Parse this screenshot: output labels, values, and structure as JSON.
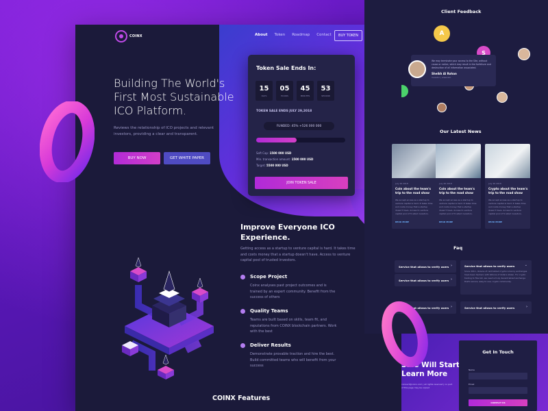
{
  "nav": {
    "logo": "COINX",
    "links": [
      "About",
      "Token",
      "Roadmap",
      "Contact"
    ],
    "buy_token": "BUY TOKEN"
  },
  "hero": {
    "title": "Building The World's First Most Sustainable ICO Platform.",
    "description": "Reviews the relationship of ICO projects and relevant investors, providing a clear and transparent.",
    "buy_now": "BUY NOW",
    "white_paper": "GET WHITE PAPER"
  },
  "token_sale": {
    "title": "Token Sale Ends In:",
    "countdown": [
      {
        "value": "15",
        "label": "DAYS"
      },
      {
        "value": "05",
        "label": "HOURS"
      },
      {
        "value": "45",
        "label": "MINUTES"
      },
      {
        "value": "53",
        "label": "SECOND"
      }
    ],
    "ends_text": "TOKEN SALE ENDS JULY 29,2018",
    "funded": "FUNDED: 45% +526 000 000",
    "progress": 0.45,
    "soft_cap_label": "Soft Cap:",
    "soft_cap": "1500 000 USD",
    "min_tx_label": "Min. transaction amount:",
    "min_tx": "1500 000 USD",
    "target_label": "Target:",
    "target": "5500 000 USD",
    "join": "JOIN TOKEN SALE"
  },
  "improve": {
    "title": "Improve Everyone ICO Experience.",
    "description": "Getting access as a startup to venture capital is hard. It takes time and costs money that a startup doesn't have. Access to venture capital pool of trusted investors.",
    "features": [
      {
        "title": "Scope Project",
        "desc": "Coinx analyses past project outcomes and is trained by an expert community. Benefit from the success of others"
      },
      {
        "title": "Quality Teams",
        "desc": "Teams are built based on skills, team fit, and reputations from COINX blockchain partners. Work with the best"
      },
      {
        "title": "Deliver Results",
        "desc": "Demonstrate provable traction and hire the best. Build committed teams who will benefit from your success"
      }
    ]
  },
  "features_heading": "COINX Features",
  "feedback": {
    "heading": "Client Feedback",
    "text": "We may terminate your access to the Site, without cause or notice, which may result in the forfeiture and destruction of all information associated.",
    "name": "Sheikh Al Rohan",
    "role": "Investor | www.abc",
    "bubbles": [
      {
        "letter": "A",
        "color": "#f5c84a"
      },
      {
        "letter": "S",
        "color": "#d94bc9"
      }
    ]
  },
  "news": {
    "heading": "Our Latest News",
    "items": [
      {
        "date": "July 26 2018",
        "title": "Coin about the team's trip to the road show",
        "desc": "We accept access as a startup to venture capital is hard. It takes time and costs money that a startup doesn't have. Access to venture capital pool of trusted investors.",
        "more": "READ MORE"
      },
      {
        "date": "July 26 2018",
        "title": "Coin about the team's trip to the road show",
        "desc": "We accept access as a startup to venture capital is hard. It takes time and costs money that a startup doesn't have. Access to venture capital pool of trusted investors.",
        "more": "READ MORE"
      },
      {
        "date": "July 26 2018",
        "title": "Crypto about the team's trip to the road show",
        "desc": "We accept access as a startup to venture capital is hard. It takes time and costs money that a startup doesn't have. Access to venture capital pool of trusted investors.",
        "more": "READ MORE"
      }
    ]
  },
  "faq": {
    "heading": "Faq",
    "left_items": [
      "Service that allows to verify users",
      "Service that allows to verify users",
      "Service that allows to verify users"
    ],
    "open_title": "Service that allows to verify users",
    "open_desc": "Since 2011, dozens of centralized cryptocurrency exchanges have been hacked, with billions of dollars stolen. For crypto trading to flourish, we need a truly decentralized exchange that's secure, easy to use, crypto community.",
    "right_item": "Service that allows to verify users"
  },
  "promo": {
    "line1": "Sale Will Start",
    "line2": "Learn More",
    "small": "connect@coinx.com | all rights reserved | no part of this page may be copied"
  },
  "contact": {
    "title": "Get In Touch",
    "name_label": "Name",
    "email_label": "Email",
    "button": "CONTACT US"
  }
}
